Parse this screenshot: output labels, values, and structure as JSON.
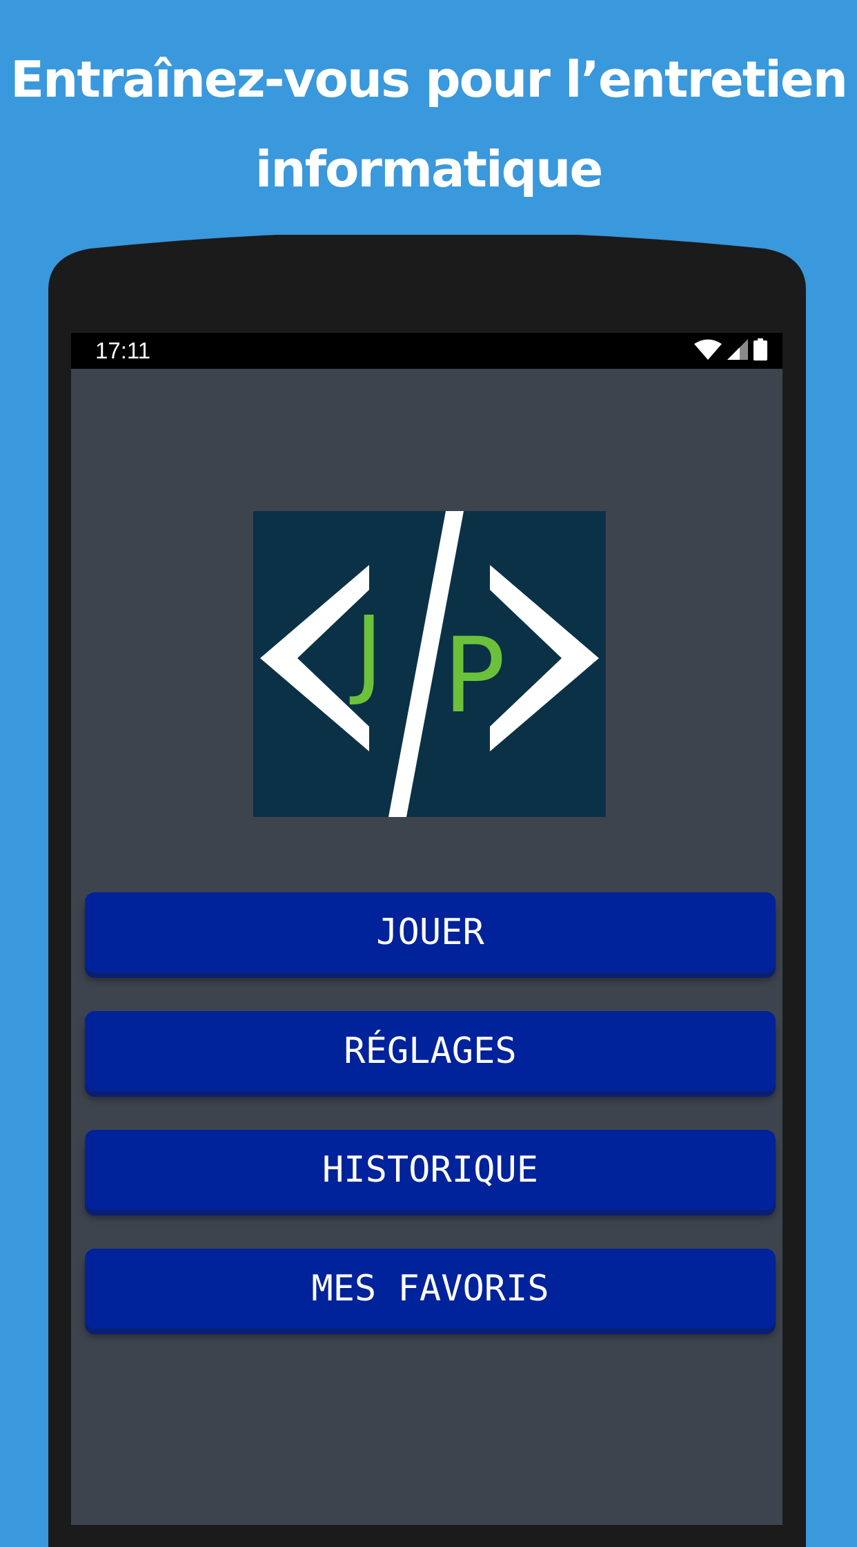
{
  "headline": {
    "line1": "Entraînez-vous pour l’entretien",
    "line2": "informatique"
  },
  "status_bar": {
    "time": "17:11",
    "icons": [
      "wifi-icon",
      "signal-icon",
      "battery-icon"
    ]
  },
  "logo": {
    "letters": "JP",
    "colors": {
      "background": "#0b3147",
      "brackets": "#ffffff",
      "letters": "#6cc13a"
    }
  },
  "menu": {
    "play_label": "JOUER",
    "settings_label": "RÉGLAGES",
    "history_label": "HISTORIQUE",
    "favorites_label": "MES FAVORIS"
  },
  "colors": {
    "page_background": "#3a98dc",
    "screen_background": "#3e444e",
    "button": "#00229a",
    "device": "#1b1b1b"
  }
}
